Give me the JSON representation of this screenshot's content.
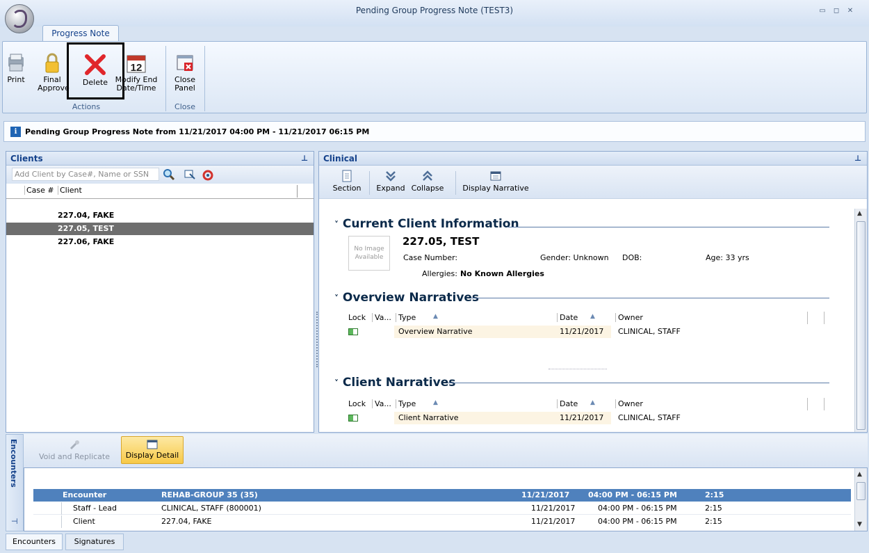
{
  "window": {
    "title": "Pending Group Progress Note (TEST3)"
  },
  "ribbon": {
    "tab": "Progress Note",
    "actions": {
      "print": "Print",
      "final_approve_1": "Final",
      "final_approve_2": "Approve",
      "delete": "Delete",
      "modify_1": "Modify End",
      "modify_2": "Date/Time",
      "group_label": "Actions",
      "calendar_number": "12"
    },
    "close": {
      "label_1": "Close",
      "label_2": "Panel",
      "group_label": "Close"
    }
  },
  "info": {
    "text": "Pending Group Progress Note from 11/21/2017 04:00 PM - 11/21/2017 06:15 PM"
  },
  "clients": {
    "title": "Clients",
    "search_placeholder": "Add Client by Case#, Name or SSN",
    "columns": {
      "case": "Case #",
      "client": "Client"
    },
    "rows": [
      "227.04, FAKE",
      "227.05, TEST",
      "227.06, FAKE"
    ]
  },
  "clinical": {
    "title": "Clinical",
    "toolbar": {
      "section": "Section",
      "expand": "Expand",
      "collapse": "Collapse",
      "display_narrative": "Display Narrative"
    },
    "current_client": {
      "header": "Current Client Information",
      "no_image": "No Image Available",
      "name": "227.05, TEST",
      "case_number": "Case Number:",
      "gender": "Gender: Unknown",
      "dob": "DOB:",
      "age": "Age: 33 yrs",
      "allergies_label": "Allergies:",
      "allergies_value": "No Known Allergies"
    },
    "overview": {
      "header": "Overview Narratives",
      "columns": {
        "lock": "Lock",
        "va": "Va...",
        "type": "Type",
        "date": "Date",
        "owner": "Owner"
      },
      "row": {
        "type": "Overview Narrative",
        "date": "11/21/2017",
        "owner": "CLINICAL, STAFF"
      }
    },
    "client_narratives": {
      "header": "Client Narratives",
      "columns": {
        "lock": "Lock",
        "va": "Va...",
        "type": "Type",
        "date": "Date",
        "owner": "Owner"
      },
      "row": {
        "type": "Client Narrative",
        "date": "11/21/2017",
        "owner": "CLINICAL, STAFF"
      }
    }
  },
  "encounters": {
    "side_title": "Encounters",
    "void_replicate": "Void and Replicate",
    "display_detail": "Display Detail",
    "header_row": {
      "label": "Encounter",
      "name": "REHAB-GROUP 35 (35)",
      "date": "11/21/2017",
      "time": "04:00 PM - 06:15 PM",
      "duration": "2:15"
    },
    "rows": [
      {
        "label": "Staff - Lead",
        "name": "CLINICAL, STAFF (800001)",
        "date": "11/21/2017",
        "time": "04:00 PM - 06:15 PM",
        "duration": "2:15"
      },
      {
        "label": "Client",
        "name": "227.04, FAKE",
        "date": "11/21/2017",
        "time": "04:00 PM - 06:15 PM",
        "duration": "2:15"
      }
    ]
  },
  "bottom_tabs": [
    "Encounters",
    "Signatures"
  ]
}
